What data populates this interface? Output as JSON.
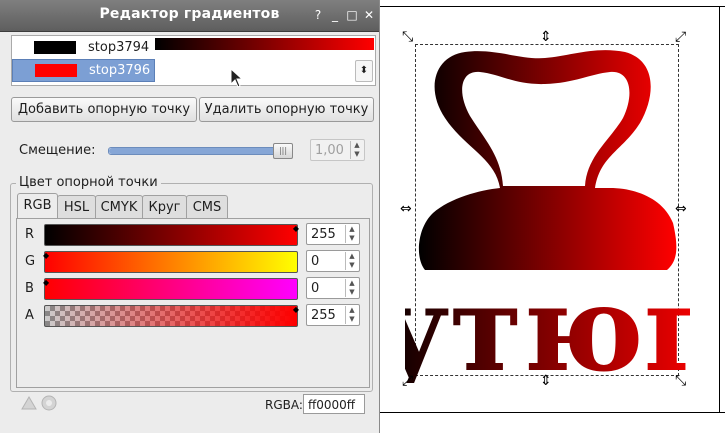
{
  "window": {
    "title": "Редактор градиентов",
    "controls": [
      "?",
      "_",
      "□",
      "✕"
    ]
  },
  "stops": [
    {
      "label": "stop3794",
      "color": "#000000"
    },
    {
      "label": "stop3796",
      "color": "#ff0000"
    }
  ],
  "buttons": {
    "add_stop": "Добавить опорную точку",
    "delete_stop": "Удалить опорную точку"
  },
  "offset": {
    "label": "Смещение:",
    "value": "1,00",
    "level": 1.0
  },
  "color_section": {
    "title": "Цвет опорной точки",
    "tabs": [
      "RGB",
      "HSL",
      "CMYK",
      "Круг",
      "CMS"
    ],
    "active_tab": "RGB",
    "channels": [
      {
        "name": "R",
        "value": "255"
      },
      {
        "name": "G",
        "value": "0"
      },
      {
        "name": "B",
        "value": "0"
      },
      {
        "name": "A",
        "value": "255"
      }
    ],
    "rgba_label": "RGBA:",
    "rgba_value": "ff0000ff"
  },
  "canvas": {
    "artwork_text": "утюг",
    "gradient_start": "#000000",
    "gradient_end": "#ff0000"
  }
}
